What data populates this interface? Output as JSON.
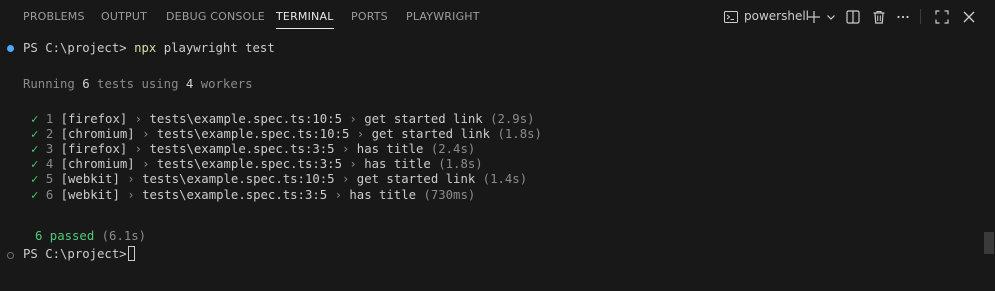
{
  "panel": {
    "tabs": [
      {
        "label": "PROBLEMS",
        "active": false
      },
      {
        "label": "OUTPUT",
        "active": false
      },
      {
        "label": "DEBUG CONSOLE",
        "active": false
      },
      {
        "label": "TERMINAL",
        "active": true
      },
      {
        "label": "PORTS",
        "active": false
      },
      {
        "label": "PLAYWRIGHT",
        "active": false
      }
    ],
    "terminal_name": "powershell",
    "icons": [
      "terminal-icon",
      "plus-icon",
      "chevron-down-icon",
      "split-icon",
      "trash-icon",
      "ellipsis-icon",
      "maximize-icon",
      "close-icon"
    ]
  },
  "terminal": {
    "prompt": "PS C:\\project>",
    "command_program": "npx",
    "command_args": "playwright test",
    "running": {
      "prefix": "Running ",
      "count": "6",
      "middle": " tests using ",
      "workers": "4",
      "suffix": " workers"
    },
    "results": [
      {
        "num": "1",
        "project": "[firefox]",
        "file": "tests\\example.spec.ts:10:5",
        "title": "get started link",
        "time": "(2.9s)"
      },
      {
        "num": "2",
        "project": "[chromium]",
        "file": "tests\\example.spec.ts:10:5",
        "title": "get started link",
        "time": "(1.8s)"
      },
      {
        "num": "3",
        "project": "[firefox]",
        "file": "tests\\example.spec.ts:3:5",
        "title": "has title",
        "time": "(2.4s)"
      },
      {
        "num": "4",
        "project": "[chromium]",
        "file": "tests\\example.spec.ts:3:5",
        "title": "has title",
        "time": "(1.8s)"
      },
      {
        "num": "5",
        "project": "[webkit]",
        "file": "tests\\example.spec.ts:10:5",
        "title": "get started link",
        "time": "(1.4s)"
      },
      {
        "num": "6",
        "project": "[webkit]",
        "file": "tests\\example.spec.ts:3:5",
        "title": "has title",
        "time": "(730ms)"
      }
    ],
    "check_mark": "✓",
    "separator": "›",
    "summary": {
      "passed": "6 passed",
      "time": "(6.1s)"
    },
    "final_prompt": "PS C:\\project>"
  },
  "colors": {
    "background": "#181818",
    "pass_green": "#4ec97b",
    "command_yellow": "#dcdcaa",
    "decoration_blue": "#4daafc"
  }
}
